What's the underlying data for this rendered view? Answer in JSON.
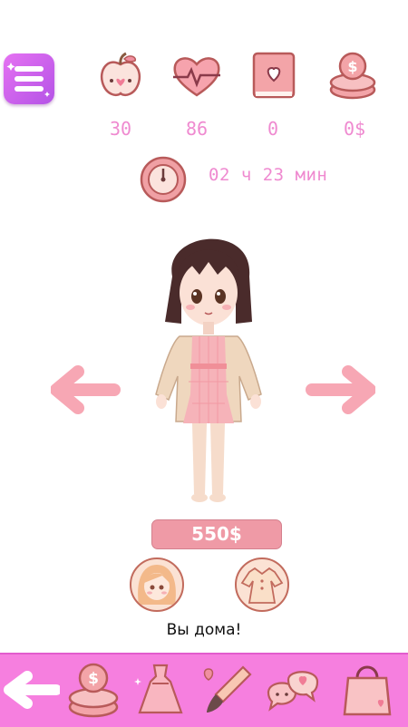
{
  "stats": [
    {
      "icon": "apple-icon",
      "value": "30"
    },
    {
      "icon": "heart-pulse-icon",
      "value": "86"
    },
    {
      "icon": "heart-book-icon",
      "value": "0"
    },
    {
      "icon": "coin-stack-icon",
      "value": "0$"
    }
  ],
  "timer": {
    "icon": "clock-icon",
    "text": "02 ч 23 мин"
  },
  "outfit": {
    "price": "550$"
  },
  "status_text": "Вы дома!",
  "nav": {
    "items": [
      {
        "icon": "back-arrow-icon"
      },
      {
        "icon": "coin-stack-icon"
      },
      {
        "icon": "dress-icon"
      },
      {
        "icon": "paintbrush-icon"
      },
      {
        "icon": "chat-bubbles-icon"
      },
      {
        "icon": "shopping-bag-icon"
      }
    ]
  },
  "colors": {
    "accent_pink": "#ef8ad0",
    "bottom_bar": "#f67fdf",
    "menu_purple": "#c45fea",
    "price_tag": "#ef9aa6"
  }
}
